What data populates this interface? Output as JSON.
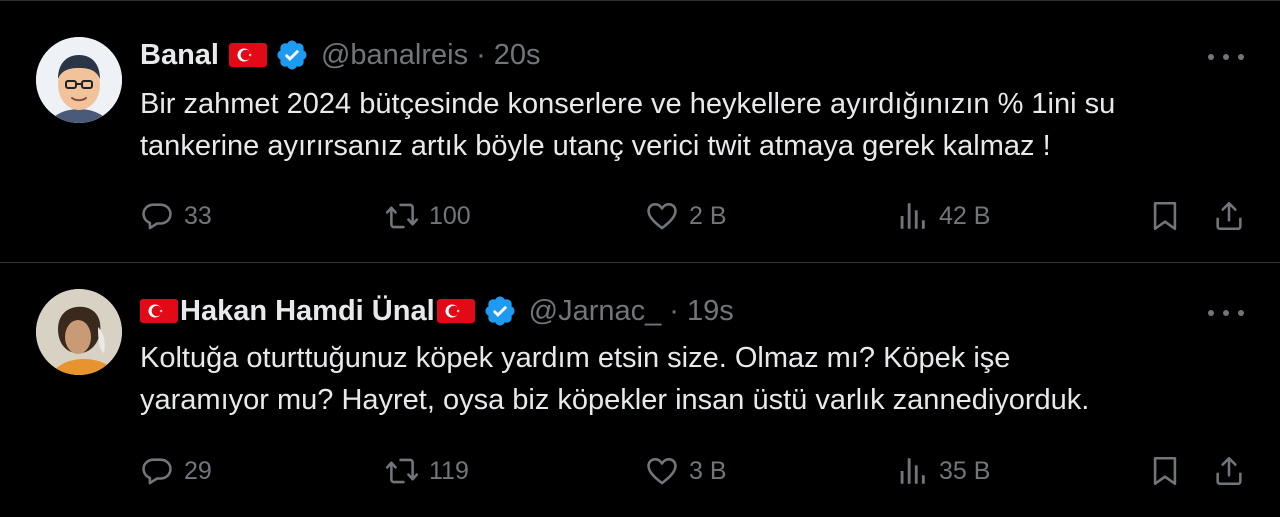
{
  "tweets": [
    {
      "name": "Banal",
      "handle": "@banalreis",
      "separator": "·",
      "time": "20s",
      "text_lines": [
        "Bir zahmet 2024 bütçesinde konserlere ve heykellere ayırdığınızın % 1ini su",
        "tankerine ayırırsanız artık böyle utanç verici twit atmaya gerek kalmaz !"
      ],
      "replies": "33",
      "retweets": "100",
      "likes": "2 B",
      "views": "42 B"
    },
    {
      "name": "Hakan Hamdi Ünal",
      "handle": "@Jarnac_",
      "separator": "·",
      "time": "19s",
      "text_lines": [
        "Koltuğa oturttuğunuz köpek yardım etsin size. Olmaz mı? Köpek işe",
        "yaramıyor mu? Hayret, oysa biz köpekler insan üstü varlık zannediyorduk."
      ],
      "replies": "29",
      "retweets": "119",
      "likes": "3 B",
      "views": "35 B"
    }
  ],
  "icons": {
    "reply": "reply-icon",
    "retweet": "retweet-icon",
    "like": "like-icon",
    "views": "views-icon",
    "bookmark": "bookmark-icon",
    "share": "share-icon",
    "more": "more-icon",
    "verified": "verified-icon",
    "flag": "turkish-flag-icon"
  },
  "colors": {
    "background": "#000000",
    "text": "#e7e9ea",
    "muted": "#71767b",
    "verified": "#1d9bf0",
    "flag_red": "#e30a17"
  }
}
